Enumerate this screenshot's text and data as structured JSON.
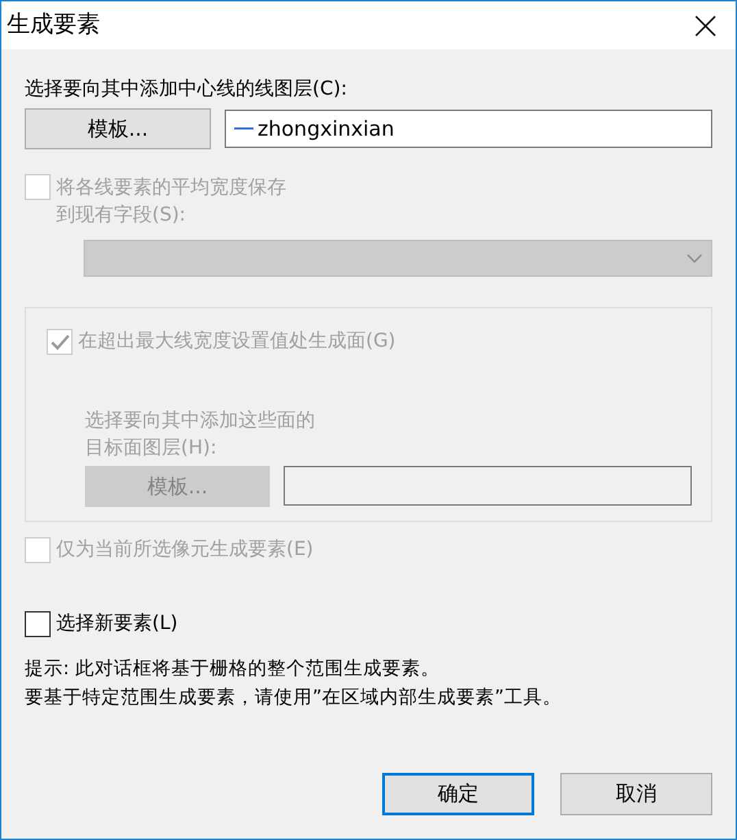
{
  "window": {
    "title": "生成要素"
  },
  "line_layer": {
    "label": "选择要向其中添加中心线的线图层(C):",
    "button": {
      "label": "模板...",
      "disabled": false
    },
    "value": "zhongxinxian"
  },
  "save_width": {
    "lines": [
      "将各线要素的平均宽度保存",
      "到现有字段(S):"
    ],
    "checked": false,
    "disabled": true
  },
  "width_field": {
    "disabled": true
  },
  "polygon_group": {
    "checkbox": {
      "label": "在超出最大线宽度设置值处生成面(G)",
      "checked": true,
      "disabled": true
    },
    "lines": [
      "选择要向其中添加这些面的",
      "目标面图层(H):"
    ],
    "button": {
      "label": "模板...",
      "disabled": true
    }
  },
  "selected_cells_only": {
    "label": "仅为当前所选像元生成要素(E)",
    "checked": false,
    "disabled": true
  },
  "select_new": {
    "label": "选择新要素(L)",
    "checked": false,
    "disabled": false
  },
  "hint": [
    "提示: 此对话框将基于栅格的整个范围生成要素。",
    "要基于特定范围生成要素，请使用”在区域内部生成要素”工具。"
  ],
  "buttons": [
    {
      "label": "确定",
      "default": true
    },
    {
      "label": "取消",
      "default": false
    }
  ]
}
